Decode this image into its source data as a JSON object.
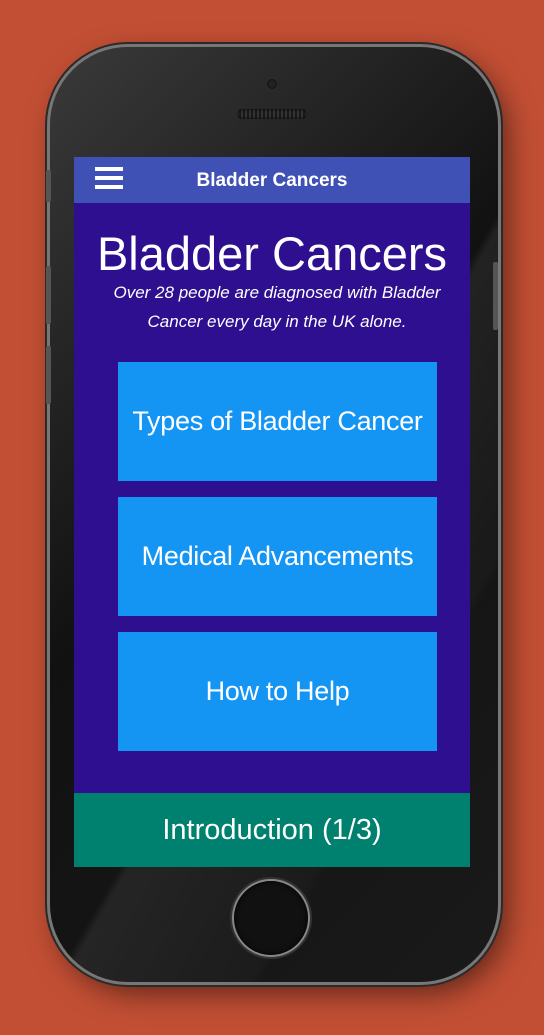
{
  "app": {
    "topbar_title": "Bladder Cancers",
    "main_title": "Bladder Cancers",
    "subtitle": "Over 28 people are diagnosed with Bladder Cancer every day in the UK alone."
  },
  "nav_buttons": [
    {
      "label": "Types of Bladder Cancer"
    },
    {
      "label": "Medical Advancements"
    },
    {
      "label": "How to Help"
    }
  ],
  "footer": {
    "label": "Introduction (1/3)"
  },
  "colors": {
    "background": "#c24f34",
    "screen": "#2d0f8f",
    "topbar": "#3f51b5",
    "button": "#1595f3",
    "footer": "#00806e"
  },
  "icons": {
    "menu": "hamburger-menu-icon"
  }
}
